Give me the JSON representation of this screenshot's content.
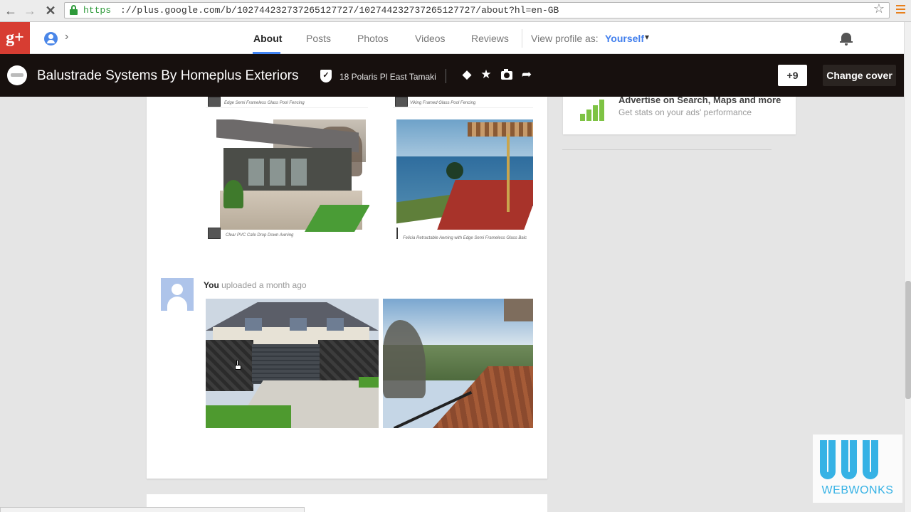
{
  "browser": {
    "url_scheme": "https",
    "url_rest": "://plus.google.com/b/102744232737265127727/102744232737265127727/about?hl=en-GB",
    "back_icon": "back-arrow-icon",
    "forward_icon": "forward-arrow-icon",
    "stop_icon": "stop-loading-icon"
  },
  "header": {
    "logo_text": "g+",
    "tabs": [
      {
        "label": "About",
        "active": true
      },
      {
        "label": "Posts"
      },
      {
        "label": "Photos"
      },
      {
        "label": "Videos"
      },
      {
        "label": "Reviews"
      }
    ],
    "view_as_label": "View profile as:",
    "view_as_value": "Yourself",
    "brand_color": "#d73d32",
    "accent_color": "#4285f4"
  },
  "titlebar": {
    "name": "Balustrade Systems By Homeplus Exteriors",
    "address": "18 Polaris Pl East Tamaki",
    "plus_count": "+9",
    "change_cover_label": "Change cover"
  },
  "photos": {
    "caption_1": "Clear PVC Cafe Drop Down Awning",
    "caption_2": "Felicia Retractable Awning with Edge Semi Frameless Glass Balc",
    "top_caption_1": "Edge Semi Frameless Glass Pool Fencing",
    "top_caption_2": "Viking Framed Glass Pool Fencing"
  },
  "post": {
    "author": "You",
    "action": " uploaded a month ago"
  },
  "sidebar": {
    "ad_title": "Advertise on Search, Maps and more",
    "ad_subtitle": "Get stats on your ads' performance"
  },
  "watermark": {
    "brand": "WEBWONKS"
  }
}
